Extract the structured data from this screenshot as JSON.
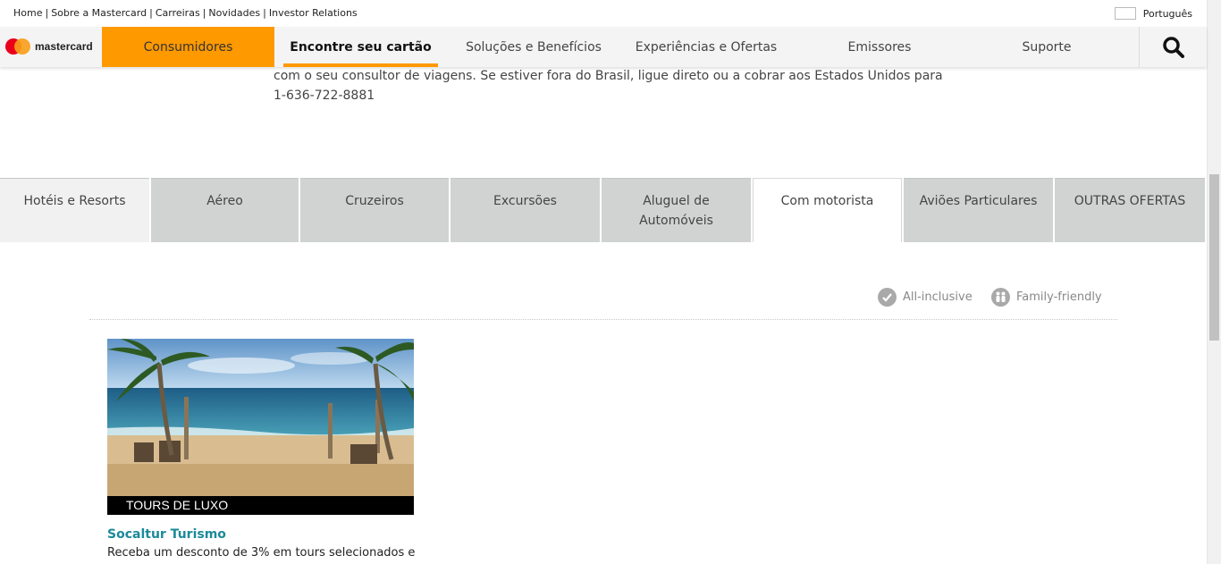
{
  "utility": {
    "links": [
      "Home",
      "Sobre a Mastercard",
      "Carreiras",
      "Novidades",
      "Investor Relations"
    ],
    "language": "Português"
  },
  "brand": {
    "logo_text": "mastercard",
    "colors": {
      "red": "#eb001b",
      "orange": "#f79e1b",
      "accent": "#ff9900",
      "teal": "#1b8a9a"
    }
  },
  "nav": {
    "consumidores": "Consumidores",
    "encontre": "Encontre seu cartão",
    "solucoes": "Soluções e Benefícios",
    "experiencias": "Experiências e Ofertas",
    "emissores": "Emissores",
    "suporte": "Suporte",
    "search_icon": "search-icon"
  },
  "intro": {
    "line1": "com o seu consultor de viagens. Se estiver fora do Brasil, ligue direto ou a cobrar aos Estados Unidos para",
    "line2": "1-636-722-8881"
  },
  "tabs": {
    "hoteis": "Hotéis e Resorts",
    "aereo": "Aéreo",
    "cruzeiros": "Cruzeiros",
    "excursoes": "Excursões",
    "aluguel_1": "Aluguel de",
    "aluguel_2": "Automóveis",
    "motorista": "Com motorista",
    "avioes": "Aviões Particulares",
    "outras": "OUTRAS OFERTAS",
    "selected": "Com motorista"
  },
  "legend": {
    "all_inclusive": "All-inclusive",
    "family_friendly": "Family-friendly"
  },
  "card": {
    "category": "TOURS DE LUXO",
    "title": "Socaltur Turismo",
    "description": "Receba um desconto de 3% em tours selecionados e"
  }
}
